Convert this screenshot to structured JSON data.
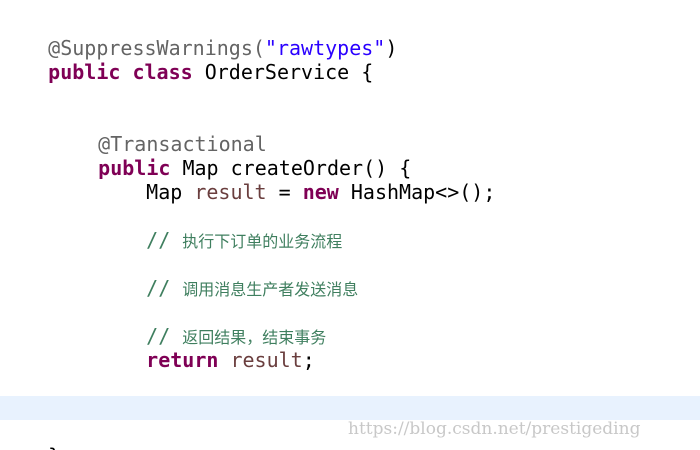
{
  "code": {
    "annotation_suppress": "@SuppressWarnings(",
    "annotation_suppress_arg": "\"rawtypes\"",
    "annotation_suppress_close": ")",
    "kw_public": "public",
    "kw_class": "class",
    "class_decl_rest": " OrderService {",
    "annotation_transactional": "@Transactional",
    "method_sig_rest": " Map createOrder() {",
    "map_type": "Map ",
    "local_result": "result",
    "assign": " = ",
    "kw_new": "new",
    "hashmap_expr": " HashMap<>();",
    "comment_slash": "// ",
    "comment_1": "执行下订单的业务流程",
    "comment_2": "调用消息生产者发送消息",
    "comment_3": "返回结果，结束事务",
    "kw_return": "return",
    "return_rest": ";",
    "method_close": "}",
    "class_close": "}"
  },
  "colors": {
    "keyword": "#7f0055",
    "string": "#2a00ff",
    "annotation": "#646464",
    "comment": "#3f7f5f",
    "local_variable": "#6a3e3e",
    "current_line_highlight": "#e8f2fe"
  },
  "watermark": {
    "text": "https://blog.csdn.net/prestigeding"
  }
}
